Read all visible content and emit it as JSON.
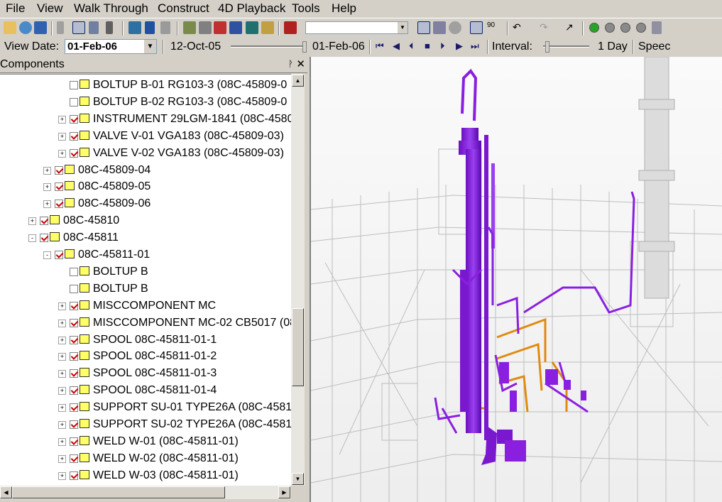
{
  "menu": [
    "File",
    "View",
    "Walk Through",
    "Construct",
    "4D Playback",
    "Tools",
    "Help"
  ],
  "toolbar": {
    "combo_value": "",
    "icons": [
      "open-icon",
      "globe-icon",
      "save-icon",
      "walk-icon",
      "select-icon",
      "run-icon",
      "person-icon",
      "chart-icon",
      "text-icon",
      "pen-icon",
      "tree-icon",
      "camera-icon",
      "brick-icon",
      "ship-icon",
      "arrow-icon",
      "layout-icon",
      "record-icon",
      "rotate-icon",
      "walk-view-icon",
      "zoom-icon",
      "view-box-icon",
      "rotate-90-icon",
      "undo-icon",
      "redo-icon",
      "pointer-icon"
    ],
    "status_lights": [
      "#27a327",
      "#8a8a8a",
      "#8a8a8a",
      "#8a8a8a"
    ],
    "rotate_label": "90"
  },
  "datebar": {
    "view_date_label": "View Date:",
    "view_date_value": "01-Feb-06",
    "start_date": "12-Oct-05",
    "end_date": "01-Feb-06",
    "interval_label": "Interval:",
    "interval_value": "1 Day",
    "speed_label": "Speec"
  },
  "panel": {
    "title": "Components",
    "pin": "ᚹ",
    "close": "✕",
    "rows": [
      {
        "indent": 2,
        "exp": "",
        "checked": false,
        "label": "BOLTUP B-01 RG103-3 (08C-45809-0"
      },
      {
        "indent": 2,
        "exp": "",
        "checked": false,
        "label": "BOLTUP B-02 RG103-3 (08C-45809-0"
      },
      {
        "indent": 2,
        "exp": "+",
        "checked": true,
        "label": "INSTRUMENT 29LGM-1841 (08C-4580"
      },
      {
        "indent": 2,
        "exp": "+",
        "checked": true,
        "label": "VALVE V-01 VGA183 (08C-45809-03)"
      },
      {
        "indent": 2,
        "exp": "+",
        "checked": true,
        "label": "VALVE V-02 VGA183 (08C-45809-03)"
      },
      {
        "indent": 1,
        "exp": "+",
        "checked": true,
        "label": "08C-45809-04"
      },
      {
        "indent": 1,
        "exp": "+",
        "checked": true,
        "label": "08C-45809-05"
      },
      {
        "indent": 1,
        "exp": "+",
        "checked": true,
        "label": "08C-45809-06"
      },
      {
        "indent": 0,
        "exp": "+",
        "checked": true,
        "label": "08C-45810"
      },
      {
        "indent": 0,
        "exp": "-",
        "checked": true,
        "label": "08C-45811"
      },
      {
        "indent": 1,
        "exp": "-",
        "checked": true,
        "label": "08C-45811-01"
      },
      {
        "indent": 2,
        "exp": "",
        "checked": false,
        "label": "BOLTUP B"
      },
      {
        "indent": 2,
        "exp": "",
        "checked": false,
        "label": "BOLTUP B"
      },
      {
        "indent": 2,
        "exp": "+",
        "checked": true,
        "label": "MISCCOMPONENT MC"
      },
      {
        "indent": 2,
        "exp": "+",
        "checked": true,
        "label": "MISCCOMPONENT MC-02 CB5017 (08"
      },
      {
        "indent": 2,
        "exp": "+",
        "checked": true,
        "label": "SPOOL 08C-45811-01-1"
      },
      {
        "indent": 2,
        "exp": "+",
        "checked": true,
        "label": "SPOOL 08C-45811-01-2"
      },
      {
        "indent": 2,
        "exp": "+",
        "checked": true,
        "label": "SPOOL 08C-45811-01-3"
      },
      {
        "indent": 2,
        "exp": "+",
        "checked": true,
        "label": "SPOOL 08C-45811-01-4"
      },
      {
        "indent": 2,
        "exp": "+",
        "checked": true,
        "label": "SUPPORT SU-01 TYPE26A (08C-4581"
      },
      {
        "indent": 2,
        "exp": "+",
        "checked": true,
        "label": "SUPPORT SU-02 TYPE26A (08C-4581"
      },
      {
        "indent": 2,
        "exp": "+",
        "checked": true,
        "label": "WELD W-01  (08C-45811-01)"
      },
      {
        "indent": 2,
        "exp": "+",
        "checked": true,
        "label": "WELD W-02  (08C-45811-01)"
      },
      {
        "indent": 2,
        "exp": "+",
        "checked": true,
        "label": "WELD W-03  (08C-45811-01)"
      }
    ]
  },
  "viewport": {
    "highlight_color": "#8a1fe0",
    "secondary_color": "#e08a10"
  }
}
